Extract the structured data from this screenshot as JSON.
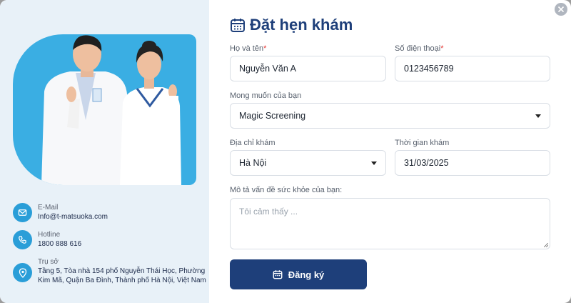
{
  "contact": {
    "email_label": "E-Mail",
    "email_value": "Info@t-matsuoka.com",
    "hotline_label": "Hotline",
    "hotline_value": "1800 888 616",
    "office_label": "Trụ sở",
    "office_value": "Tầng 5, Tòa nhà 154 phố Nguyễn Thái Học, Phường Kim Mã, Quận Ba Đình, Thành phố Hà Nội, Việt Nam"
  },
  "form": {
    "title": "Đặt hẹn khám",
    "name_label": "Họ và tên",
    "name_value": "Nguyễn Văn A",
    "phone_label": "Số điện thoại",
    "phone_value": "0123456789",
    "required_mark": "*",
    "wish_label": "Mong muốn của bạn",
    "wish_value": "Magic Screening",
    "address_label": "Địa chỉ khám",
    "address_value": "Hà Nội",
    "time_label": "Thời gian khám",
    "time_value": "31/03/2025",
    "desc_label": "Mô tả vấn đề sức khỏe của bạn:",
    "desc_placeholder": "Tôi cảm thấy ...",
    "submit_label": "Đăng ký"
  },
  "colors": {
    "primary": "#1e3f7a",
    "accent": "#2a9ed8",
    "photo_bg": "#3aaee3",
    "panel_bg": "#e8f1f8",
    "required": "#e53935"
  },
  "icons": {
    "title": "calendar-icon",
    "email": "mail-icon",
    "hotline": "phone-icon",
    "office": "location-pin-icon",
    "close": "close-icon",
    "submit": "calendar-icon"
  }
}
